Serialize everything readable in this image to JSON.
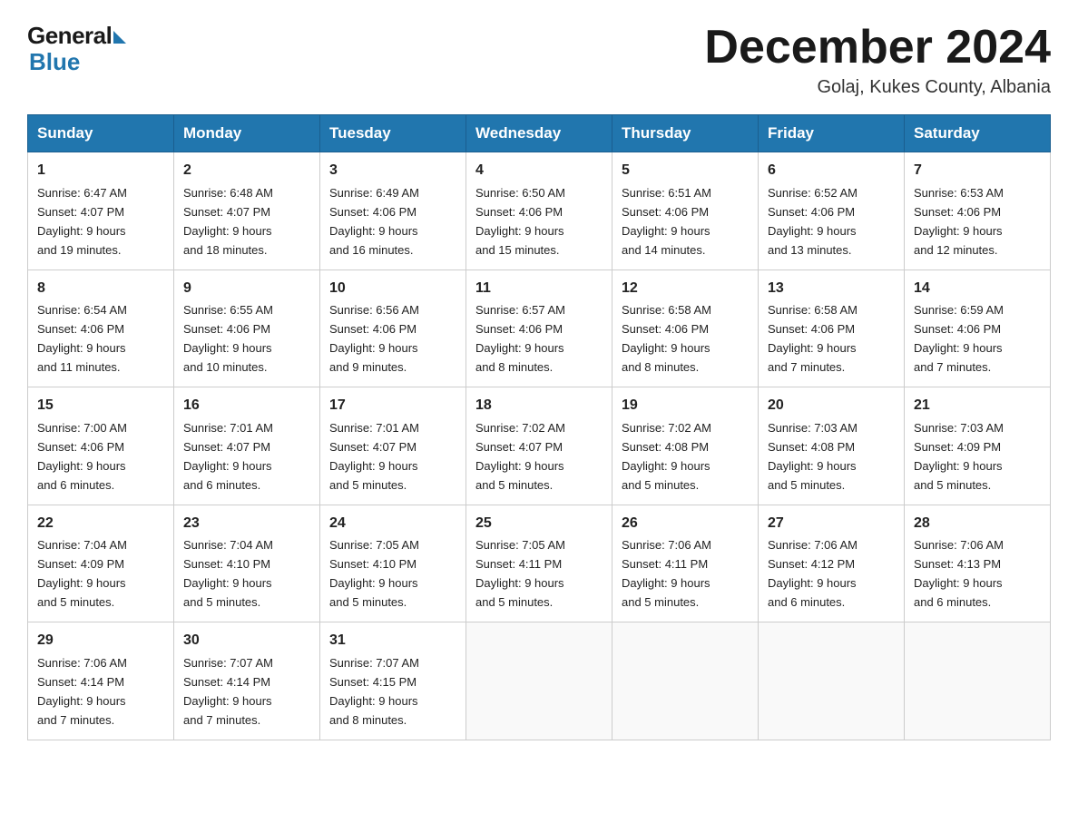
{
  "header": {
    "logo_general": "General",
    "logo_blue": "Blue",
    "month_title": "December 2024",
    "location": "Golaj, Kukes County, Albania"
  },
  "days_of_week": [
    "Sunday",
    "Monday",
    "Tuesday",
    "Wednesday",
    "Thursday",
    "Friday",
    "Saturday"
  ],
  "weeks": [
    [
      {
        "day": "1",
        "sunrise": "6:47 AM",
        "sunset": "4:07 PM",
        "daylight": "9 hours and 19 minutes."
      },
      {
        "day": "2",
        "sunrise": "6:48 AM",
        "sunset": "4:07 PM",
        "daylight": "9 hours and 18 minutes."
      },
      {
        "day": "3",
        "sunrise": "6:49 AM",
        "sunset": "4:06 PM",
        "daylight": "9 hours and 16 minutes."
      },
      {
        "day": "4",
        "sunrise": "6:50 AM",
        "sunset": "4:06 PM",
        "daylight": "9 hours and 15 minutes."
      },
      {
        "day": "5",
        "sunrise": "6:51 AM",
        "sunset": "4:06 PM",
        "daylight": "9 hours and 14 minutes."
      },
      {
        "day": "6",
        "sunrise": "6:52 AM",
        "sunset": "4:06 PM",
        "daylight": "9 hours and 13 minutes."
      },
      {
        "day": "7",
        "sunrise": "6:53 AM",
        "sunset": "4:06 PM",
        "daylight": "9 hours and 12 minutes."
      }
    ],
    [
      {
        "day": "8",
        "sunrise": "6:54 AM",
        "sunset": "4:06 PM",
        "daylight": "9 hours and 11 minutes."
      },
      {
        "day": "9",
        "sunrise": "6:55 AM",
        "sunset": "4:06 PM",
        "daylight": "9 hours and 10 minutes."
      },
      {
        "day": "10",
        "sunrise": "6:56 AM",
        "sunset": "4:06 PM",
        "daylight": "9 hours and 9 minutes."
      },
      {
        "day": "11",
        "sunrise": "6:57 AM",
        "sunset": "4:06 PM",
        "daylight": "9 hours and 8 minutes."
      },
      {
        "day": "12",
        "sunrise": "6:58 AM",
        "sunset": "4:06 PM",
        "daylight": "9 hours and 8 minutes."
      },
      {
        "day": "13",
        "sunrise": "6:58 AM",
        "sunset": "4:06 PM",
        "daylight": "9 hours and 7 minutes."
      },
      {
        "day": "14",
        "sunrise": "6:59 AM",
        "sunset": "4:06 PM",
        "daylight": "9 hours and 7 minutes."
      }
    ],
    [
      {
        "day": "15",
        "sunrise": "7:00 AM",
        "sunset": "4:06 PM",
        "daylight": "9 hours and 6 minutes."
      },
      {
        "day": "16",
        "sunrise": "7:01 AM",
        "sunset": "4:07 PM",
        "daylight": "9 hours and 6 minutes."
      },
      {
        "day": "17",
        "sunrise": "7:01 AM",
        "sunset": "4:07 PM",
        "daylight": "9 hours and 5 minutes."
      },
      {
        "day": "18",
        "sunrise": "7:02 AM",
        "sunset": "4:07 PM",
        "daylight": "9 hours and 5 minutes."
      },
      {
        "day": "19",
        "sunrise": "7:02 AM",
        "sunset": "4:08 PM",
        "daylight": "9 hours and 5 minutes."
      },
      {
        "day": "20",
        "sunrise": "7:03 AM",
        "sunset": "4:08 PM",
        "daylight": "9 hours and 5 minutes."
      },
      {
        "day": "21",
        "sunrise": "7:03 AM",
        "sunset": "4:09 PM",
        "daylight": "9 hours and 5 minutes."
      }
    ],
    [
      {
        "day": "22",
        "sunrise": "7:04 AM",
        "sunset": "4:09 PM",
        "daylight": "9 hours and 5 minutes."
      },
      {
        "day": "23",
        "sunrise": "7:04 AM",
        "sunset": "4:10 PM",
        "daylight": "9 hours and 5 minutes."
      },
      {
        "day": "24",
        "sunrise": "7:05 AM",
        "sunset": "4:10 PM",
        "daylight": "9 hours and 5 minutes."
      },
      {
        "day": "25",
        "sunrise": "7:05 AM",
        "sunset": "4:11 PM",
        "daylight": "9 hours and 5 minutes."
      },
      {
        "day": "26",
        "sunrise": "7:06 AM",
        "sunset": "4:11 PM",
        "daylight": "9 hours and 5 minutes."
      },
      {
        "day": "27",
        "sunrise": "7:06 AM",
        "sunset": "4:12 PM",
        "daylight": "9 hours and 6 minutes."
      },
      {
        "day": "28",
        "sunrise": "7:06 AM",
        "sunset": "4:13 PM",
        "daylight": "9 hours and 6 minutes."
      }
    ],
    [
      {
        "day": "29",
        "sunrise": "7:06 AM",
        "sunset": "4:14 PM",
        "daylight": "9 hours and 7 minutes."
      },
      {
        "day": "30",
        "sunrise": "7:07 AM",
        "sunset": "4:14 PM",
        "daylight": "9 hours and 7 minutes."
      },
      {
        "day": "31",
        "sunrise": "7:07 AM",
        "sunset": "4:15 PM",
        "daylight": "9 hours and 8 minutes."
      },
      null,
      null,
      null,
      null
    ]
  ]
}
